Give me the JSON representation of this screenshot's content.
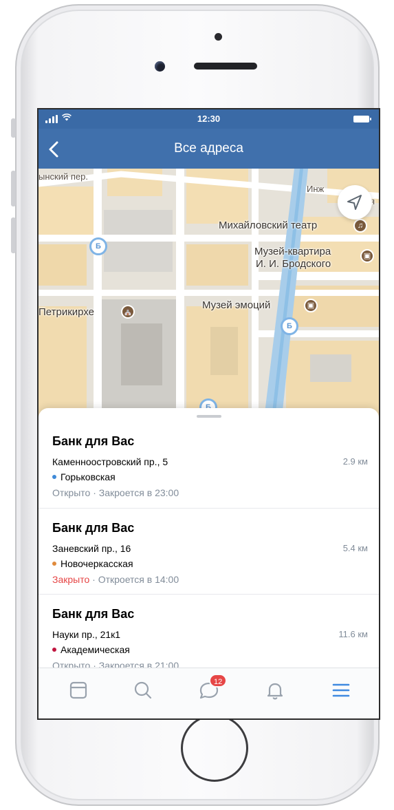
{
  "status_bar": {
    "time": "12:30"
  },
  "nav": {
    "title": "Все адреса"
  },
  "map": {
    "labels": {
      "street_top_left": "ынский пер.",
      "street_top_right": "Инж",
      "theatre": "Михайловский театр",
      "museum_flat_line1": "Музей-квартира",
      "museum_flat_line2": "И. И. Бродского",
      "church": "Петрикирхе",
      "museum_emotions": "Музей эмоций",
      "metro_symbol": "Б",
      "edge_letter": "я"
    }
  },
  "places": [
    {
      "title": "Банк для Вас",
      "address": "Каменноостровский пр., 5",
      "distance": "2.9 км",
      "metro": "Горьковская",
      "metro_color": "#3f8ad8",
      "status": "Открыто",
      "status_color": "#818c99",
      "status_detail": "· Закроется в 23:00"
    },
    {
      "title": "Банк для Вас",
      "address": "Заневский пр., 16",
      "distance": "5.4 км",
      "metro": "Новочеркасская",
      "metro_color": "#e08a3c",
      "status": "Закрыто",
      "status_color": "#e64646",
      "status_detail": "· Откроется в 14:00"
    },
    {
      "title": "Банк для Вас",
      "address": "Науки пр., 21к1",
      "distance": "11.6 км",
      "metro": "Академическая",
      "metro_color": "#c0153f",
      "status": "Открыто",
      "status_color": "#818c99",
      "status_detail": "· Закроется в 21:00"
    }
  ],
  "tabbar": {
    "messages_badge": "12"
  },
  "colors": {
    "accent": "#4070ac",
    "tab_active": "#3f8ae0",
    "tab_inactive": "#99a2ad"
  }
}
